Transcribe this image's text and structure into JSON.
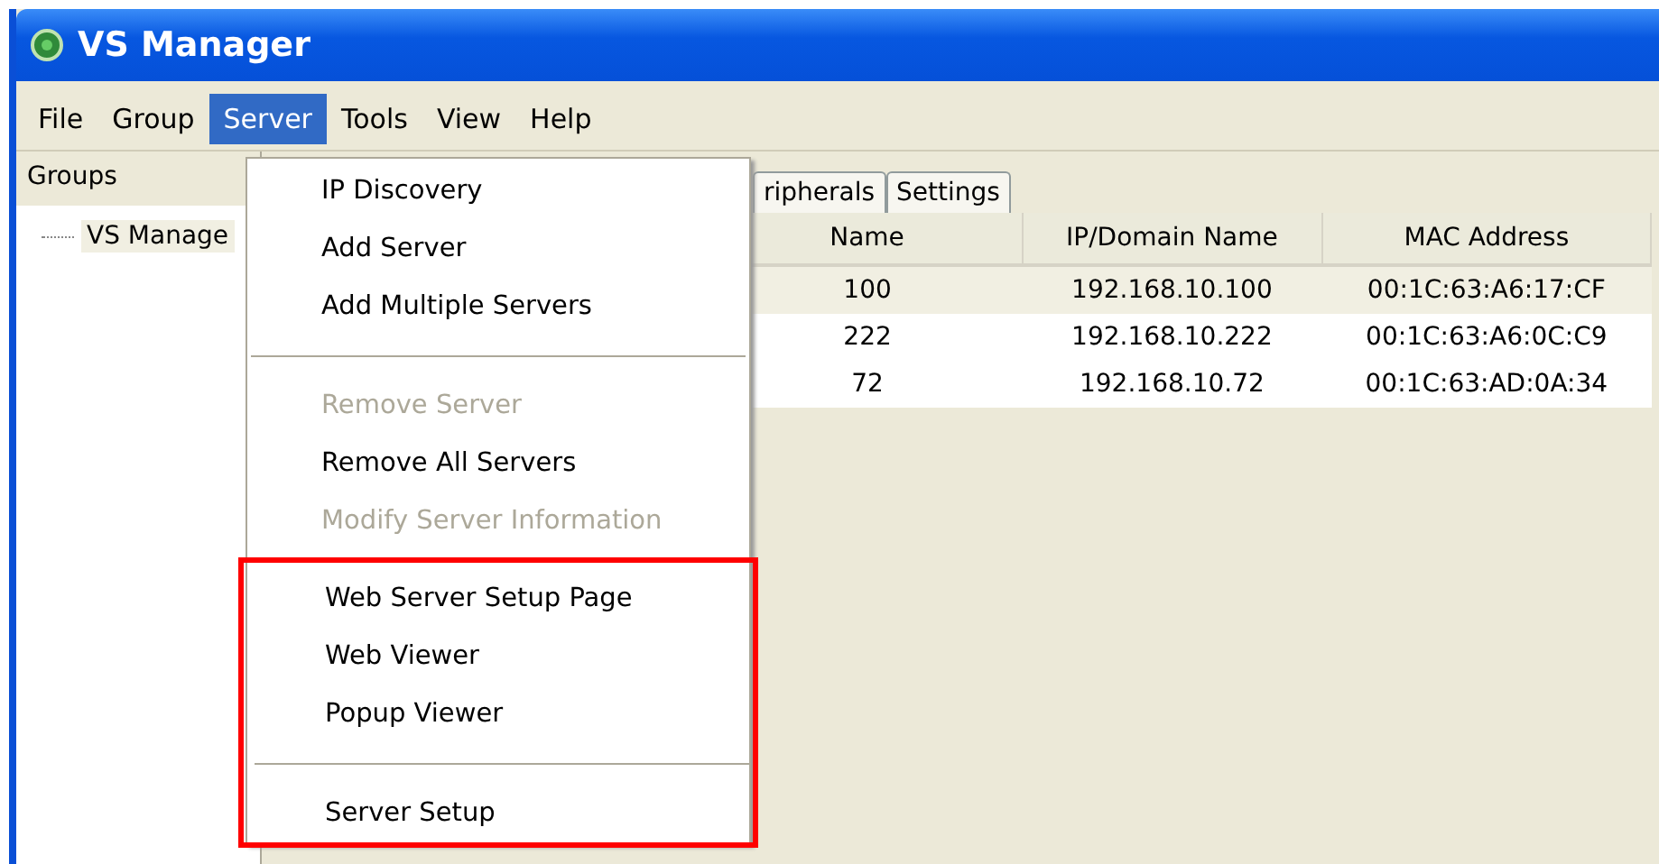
{
  "window": {
    "title": "VS Manager"
  },
  "menu_bar": [
    {
      "label": "File",
      "selected": false
    },
    {
      "label": "Group",
      "selected": false
    },
    {
      "label": "Server",
      "selected": true
    },
    {
      "label": "Tools",
      "selected": false
    },
    {
      "label": "View",
      "selected": false
    },
    {
      "label": "Help",
      "selected": false
    }
  ],
  "groups_panel": {
    "title": "Groups",
    "tree": [
      {
        "label": "VS Manage"
      }
    ]
  },
  "tabs": [
    {
      "label": "ripherals",
      "selected": false
    },
    {
      "label": "Settings",
      "selected": false
    }
  ],
  "table": {
    "columns": [
      "Name",
      "IP/Domain Name",
      "MAC Address"
    ],
    "rows": [
      {
        "cells": [
          "100",
          "192.168.10.100",
          "00:1C:63:A6:17:CF"
        ],
        "selected": true
      },
      {
        "cells": [
          "222",
          "192.168.10.222",
          "00:1C:63:A6:0C:C9"
        ],
        "selected": false
      },
      {
        "cells": [
          "72",
          "192.168.10.72",
          "00:1C:63:AD:0A:34"
        ],
        "selected": false
      }
    ]
  },
  "server_menu": [
    {
      "kind": "item",
      "label": "IP Discovery",
      "disabled": false,
      "highlighted": false
    },
    {
      "kind": "item",
      "label": "Add Server",
      "disabled": false,
      "highlighted": false
    },
    {
      "kind": "item",
      "label": "Add Multiple Servers",
      "disabled": false,
      "highlighted": false
    },
    {
      "kind": "separator"
    },
    {
      "kind": "item",
      "label": "Remove Server",
      "disabled": true,
      "highlighted": false
    },
    {
      "kind": "item",
      "label": "Remove All Servers",
      "disabled": false,
      "highlighted": false
    },
    {
      "kind": "item",
      "label": "Modify Server Information",
      "disabled": true,
      "highlighted": false
    },
    {
      "kind": "item",
      "label": "Web Server Setup Page",
      "disabled": false,
      "highlighted": true
    },
    {
      "kind": "item",
      "label": "Web Viewer",
      "disabled": false,
      "highlighted": true
    },
    {
      "kind": "item",
      "label": "Popup Viewer",
      "disabled": false,
      "highlighted": true
    },
    {
      "kind": "separator"
    },
    {
      "kind": "item",
      "label": "Server Setup",
      "disabled": false,
      "highlighted": true
    }
  ]
}
